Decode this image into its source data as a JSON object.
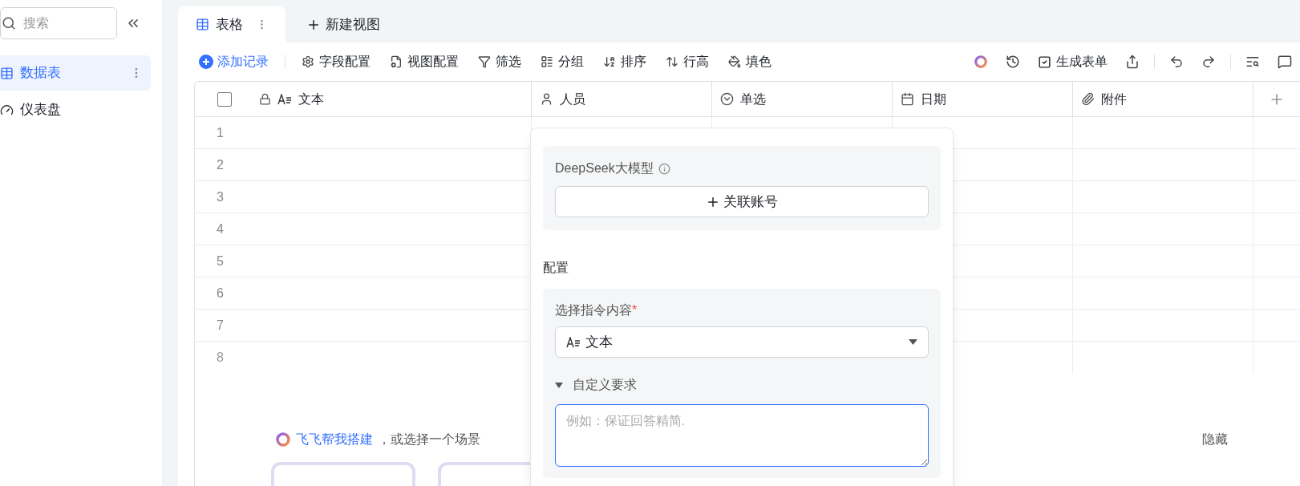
{
  "sidebar": {
    "search_placeholder": "搜索",
    "items": [
      {
        "kind": "table",
        "label": "数据表",
        "selected": true
      },
      {
        "kind": "dashboard",
        "label": "仪表盘",
        "selected": false
      }
    ]
  },
  "tabs": [
    {
      "label": "表格",
      "selected": true
    }
  ],
  "new_view": "新建视图",
  "toolbar": {
    "add": "添加记录",
    "left": [
      {
        "kind": "gear",
        "label": "字段配置"
      },
      {
        "kind": "view",
        "label": "视图配置"
      },
      {
        "kind": "filter",
        "label": "筛选"
      },
      {
        "kind": "group",
        "label": "分组"
      },
      {
        "kind": "sort",
        "label": "排序"
      },
      {
        "kind": "height",
        "label": "行高"
      },
      {
        "kind": "fill",
        "label": "填色"
      }
    ],
    "right": [
      {
        "kind": "ai"
      },
      {
        "kind": "history"
      },
      {
        "kind": "form",
        "label": "生成表单"
      },
      {
        "kind": "share"
      },
      {
        "kind": "undo"
      },
      {
        "kind": "redo"
      },
      {
        "kind": "find"
      },
      {
        "kind": "comment"
      }
    ]
  },
  "table": {
    "select_all": {
      "checked": false
    },
    "columns": [
      {
        "kind": "text",
        "label": "文本"
      },
      {
        "kind": "person",
        "label": "人员"
      },
      {
        "kind": "select",
        "label": "单选"
      },
      {
        "kind": "date",
        "label": "日期"
      },
      {
        "kind": "attachment",
        "label": "附件"
      }
    ],
    "rows": [
      "1",
      "2",
      "3",
      "4",
      "5",
      "6",
      "7",
      "8"
    ]
  },
  "popup": {
    "model_label": "DeepSeek大模型",
    "link_button": "关联账号",
    "section": "配置",
    "field_label": "选择指令内容",
    "required_mark": "*",
    "select_value": "文本",
    "custom_label": "自定义要求",
    "custom_expanded": true,
    "textarea_placeholder": "例如：保证回答精简."
  },
  "footer": {
    "link": "飞飞帮我搭建",
    "text": "，或选择一个场景",
    "hide": "隐藏"
  }
}
